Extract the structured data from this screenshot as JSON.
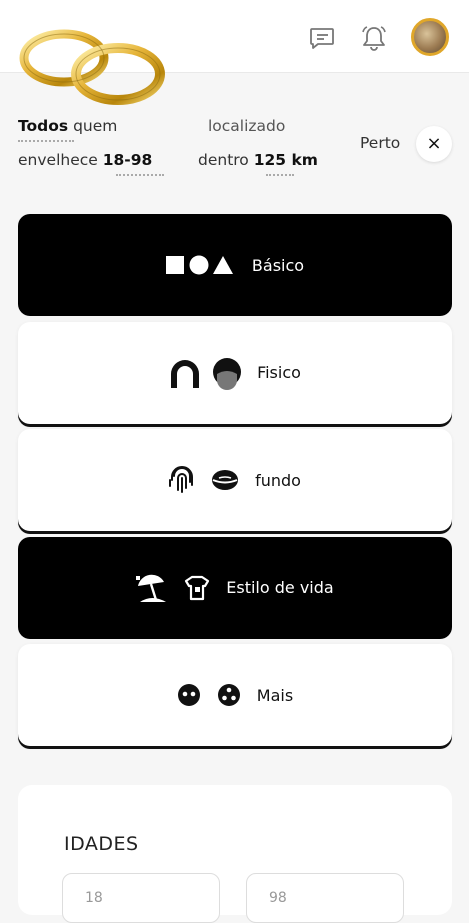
{
  "header": {
    "icons": [
      "wedding-rings-logo",
      "chat-icon",
      "bell-icon",
      "avatar"
    ]
  },
  "filters": {
    "todos": "Todos",
    "quem": "quem",
    "envelhece": "envelhece",
    "age_range": "18-98",
    "localizado": "localizado",
    "dentro": "dentro",
    "distance": "125 km",
    "perto": "Perto",
    "close_symbol": "×"
  },
  "categories": [
    {
      "label": "Básico",
      "theme": "dark"
    },
    {
      "label": "Fisico",
      "theme": "light"
    },
    {
      "label": "fundo",
      "theme": "light"
    },
    {
      "label": "Estilo de vida",
      "theme": "dark"
    },
    {
      "label": "Mais",
      "theme": "light"
    }
  ],
  "ages": {
    "title": "IDADES",
    "min_placeholder": "18",
    "max_placeholder": "98"
  },
  "colors": {
    "gold": "#e0a72a",
    "dark_card": "#000000",
    "light_card": "#ffffff"
  }
}
